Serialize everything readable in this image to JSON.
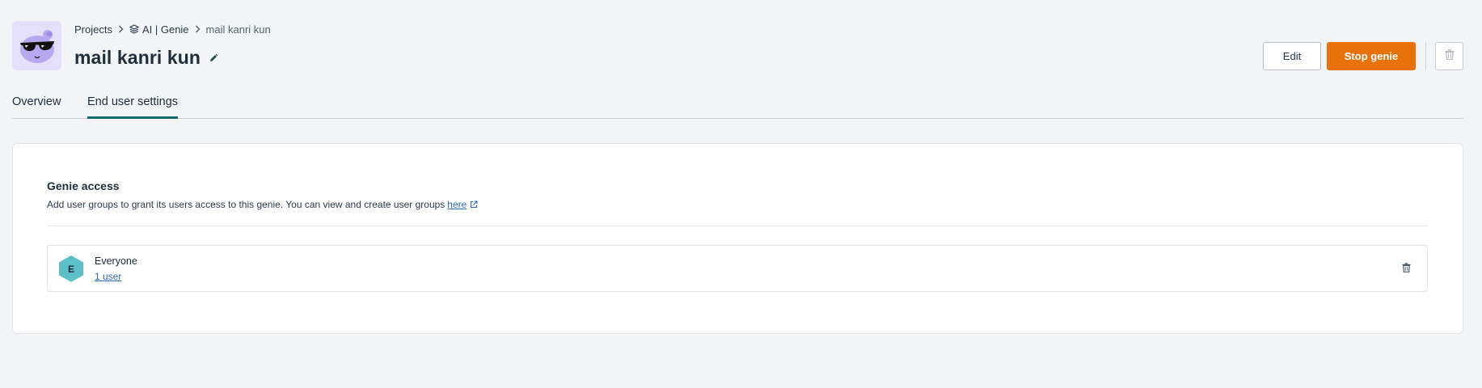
{
  "breadcrumb": {
    "projects": "Projects",
    "genie": "AI | Genie",
    "current": "mail kanri kun"
  },
  "header": {
    "title": "mail kanri kun",
    "edit_label": "Edit",
    "stop_label": "Stop genie"
  },
  "tabs": [
    {
      "label": "Overview",
      "active": false
    },
    {
      "label": "End user settings",
      "active": true
    }
  ],
  "access": {
    "title": "Genie access",
    "description": "Add user groups to grant its users access to this genie. You can view and create user groups",
    "link_text": "here"
  },
  "groups": [
    {
      "initial": "E",
      "name": "Everyone",
      "count": "1 user"
    }
  ],
  "colors": {
    "accent": "#e8710a",
    "tab_underline": "#106a6e",
    "link": "#2f68b4",
    "group_badge": "#5dbfc7"
  }
}
